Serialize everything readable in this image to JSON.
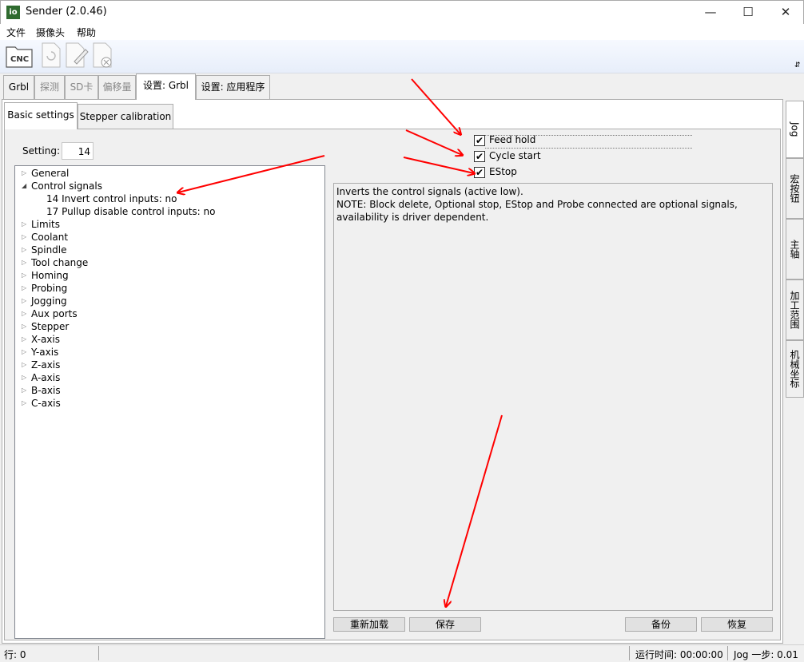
{
  "window": {
    "title": "Sender (2.0.46)",
    "icon_text": "io",
    "minimize": "—",
    "maximize": "☐",
    "close": "✕"
  },
  "menu": [
    "文件",
    "摄像头",
    "帮助"
  ],
  "toolbar": {
    "cnc_label": "CNC"
  },
  "main_tabs": [
    "Grbl",
    "探测",
    "SD卡",
    "偏移量",
    "设置: Grbl",
    "设置: 应用程序"
  ],
  "sub_tabs": [
    "Basic settings",
    "Stepper calibration"
  ],
  "setting": {
    "label": "Setting:",
    "value": "14"
  },
  "tree": {
    "items": [
      "General",
      "Control signals",
      "Limits",
      "Coolant",
      "Spindle",
      "Tool change",
      "Homing",
      "Probing",
      "Jogging",
      "Aux ports",
      "Stepper",
      "X-axis",
      "Y-axis",
      "Z-axis",
      "A-axis",
      "B-axis",
      "C-axis"
    ],
    "children": [
      "14 Invert control inputs: no",
      "17 Pullup disable control inputs: no"
    ]
  },
  "checkboxes": [
    {
      "label": "Feed hold",
      "checked": true
    },
    {
      "label": "Cycle start",
      "checked": true
    },
    {
      "label": "EStop",
      "checked": true
    }
  ],
  "description": {
    "line1": "Inverts the control signals (active low).",
    "line2": "NOTE: Block delete, Optional stop, EStop and Probe connected are optional signals,",
    "line3": "availability is driver dependent."
  },
  "buttons": {
    "reload": "重新加载",
    "save": "保存",
    "backup": "备份",
    "restore": "恢复"
  },
  "side_tabs": [
    "Jog",
    "宏按钮",
    "主轴",
    "加工范围",
    "机械坐标"
  ],
  "status": {
    "line": "行: 0",
    "runtime": "运行时间: 00:00:00",
    "jog_step": "Jog 一步: 0.01"
  },
  "colors": {
    "annotation_arrow": "#ff0000",
    "icon_green": "#2f6b2f"
  }
}
